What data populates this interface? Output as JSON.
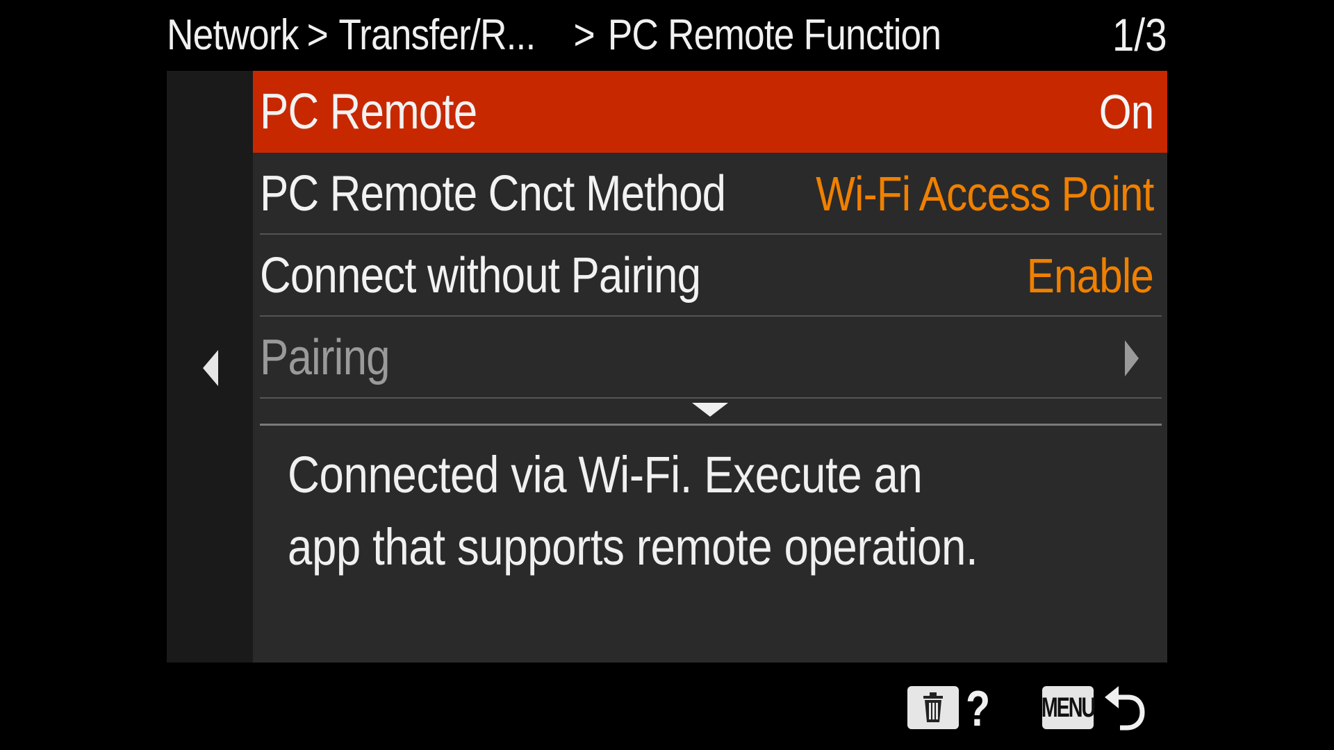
{
  "header": {
    "breadcrumb": [
      "Network",
      "Transfer/R...",
      "PC Remote Function"
    ],
    "sep1": ">",
    "sep2": ">",
    "page_counter": "1/3"
  },
  "menu": {
    "items": [
      {
        "label": "PC Remote",
        "value": "On",
        "selected": true
      },
      {
        "label": "PC Remote Cnct Method",
        "value": "Wi-Fi Access Point"
      },
      {
        "label": "Connect without Pairing",
        "value": "Enable"
      },
      {
        "label": "Pairing",
        "value": "",
        "disabled": true,
        "has_submenu": true
      }
    ]
  },
  "help": {
    "line1": "Connected via Wi-Fi. Execute an",
    "line2": "app that supports remote operation."
  },
  "footer": {
    "question": "?",
    "menu_label": "MENU"
  },
  "icons": {
    "prev": "triangle-left-icon",
    "submenu": "chevron-right-icon",
    "scroll_down": "triangle-down-icon",
    "delete": "trash-icon",
    "help": "question-icon",
    "back": "return-arrow-icon"
  },
  "colors": {
    "selected_row": "#c82800",
    "value_text": "#f08000",
    "background": "#000000",
    "panel": "#2a2a2a"
  }
}
